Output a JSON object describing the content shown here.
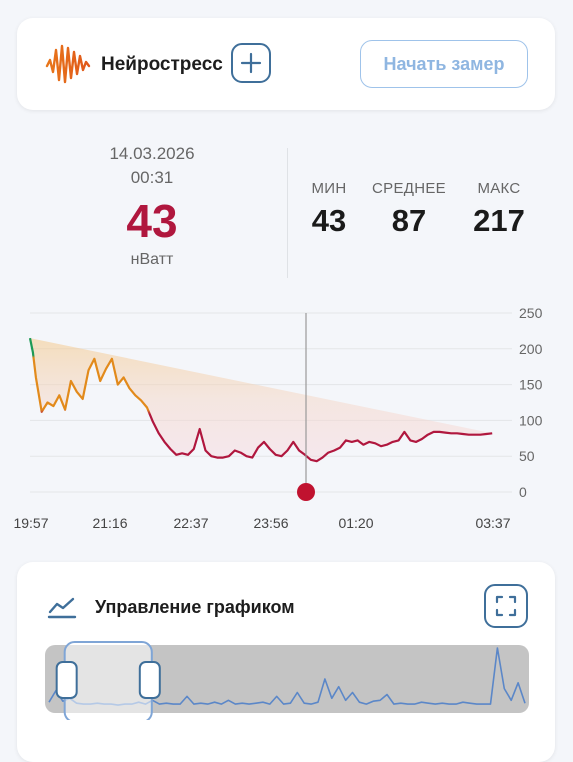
{
  "header": {
    "title": "Нейростресс",
    "start_button": "Начать замер"
  },
  "current": {
    "date": "14.03.2026",
    "time": "00:31",
    "value": "43",
    "unit": "нВатт"
  },
  "stats": {
    "min_label": "МИН",
    "min_value": "43",
    "avg_label": "СРЕДНЕЕ",
    "avg_value": "87",
    "max_label": "МАКС",
    "max_value": "217"
  },
  "chart_data": {
    "type": "line",
    "y_ticks": [
      "250",
      "200",
      "150",
      "100",
      "50",
      "0"
    ],
    "ylim": [
      0,
      250
    ],
    "x_ticks": [
      "19:57",
      "21:16",
      "22:37",
      "23:56",
      "01:20",
      "03:37"
    ],
    "cursor_value": 0,
    "x": [
      0,
      0.5,
      1,
      2,
      3,
      4,
      5,
      6,
      7,
      8,
      9,
      10,
      11,
      12,
      13,
      14,
      15,
      16,
      17,
      18,
      19,
      20,
      21,
      22,
      23,
      24,
      25,
      26,
      27,
      28,
      29,
      30,
      31,
      32,
      33,
      34,
      35,
      36,
      37,
      38,
      39,
      40,
      41,
      42,
      43,
      44,
      45,
      46,
      47,
      48,
      49,
      50,
      51,
      52,
      53,
      54,
      55,
      56,
      57,
      58,
      59,
      60,
      61,
      62,
      63,
      64,
      65,
      66,
      67,
      68,
      69,
      70,
      71,
      72,
      73,
      74,
      75,
      76,
      77,
      78,
      79,
      80
    ],
    "values": [
      215,
      195,
      160,
      112,
      125,
      120,
      135,
      115,
      155,
      140,
      130,
      170,
      186,
      155,
      172,
      186,
      150,
      160,
      145,
      135,
      128,
      118,
      98,
      82,
      70,
      60,
      52,
      54,
      52,
      60,
      88,
      58,
      50,
      48,
      48,
      50,
      58,
      55,
      50,
      48,
      62,
      70,
      60,
      52,
      50,
      58,
      70,
      58,
      52,
      45,
      43,
      48,
      55,
      58,
      62,
      72,
      70,
      72,
      66,
      70,
      68,
      64,
      66,
      70,
      72,
      84,
      72,
      70,
      74,
      80,
      84,
      84,
      83,
      82,
      82,
      81,
      80,
      80,
      80,
      81,
      82
    ]
  },
  "control": {
    "title": "Управление графиком",
    "navigator_series": [
      6,
      18,
      7,
      10,
      5,
      4,
      4,
      5,
      4,
      4,
      3,
      4,
      4,
      6,
      4,
      8,
      4,
      5,
      4,
      4,
      12,
      4,
      5,
      4,
      6,
      4,
      8,
      4,
      5,
      4,
      5,
      6,
      4,
      12,
      4,
      5,
      16,
      5,
      4,
      6,
      30,
      10,
      22,
      8,
      16,
      6,
      4,
      7,
      8,
      14,
      4,
      5,
      4,
      4,
      6,
      5,
      4,
      5,
      4,
      4,
      6,
      5,
      4,
      4,
      4,
      62,
      20,
      8,
      26,
      5
    ],
    "window_start_fraction": 0.02,
    "window_end_fraction": 0.2
  },
  "colors": {
    "accent_red": "#b0173e",
    "accent_orange": "#e28a1b",
    "accent_green": "#1e9a56",
    "accent_blue": "#3f6f9a"
  }
}
